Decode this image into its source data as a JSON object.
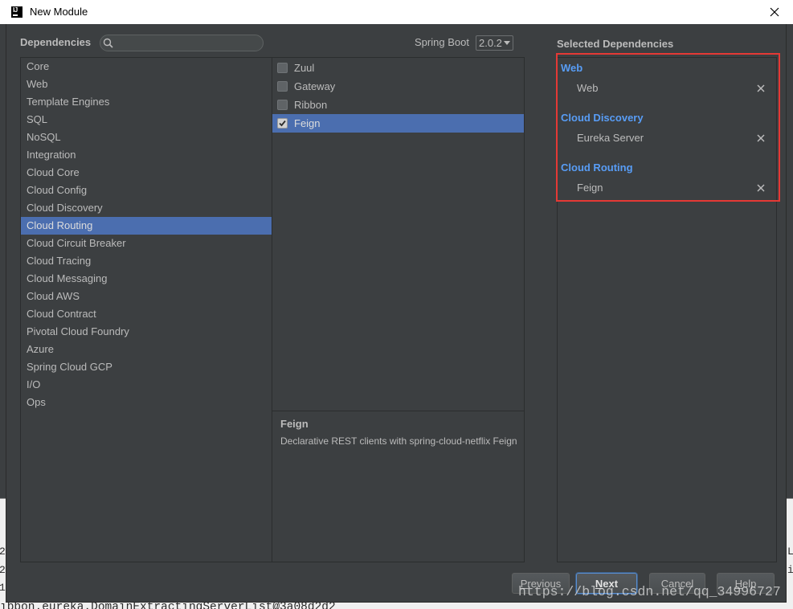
{
  "window": {
    "title": "New Module",
    "app_icon": {
      "name": "intellij-icon",
      "text": "IJ"
    },
    "close_icon": "close-icon"
  },
  "header": {
    "dependencies_label": "Dependencies",
    "search": {
      "value": "",
      "icon": "search-icon"
    },
    "spring_boot_label": "Spring Boot",
    "spring_boot_version": "2.0.2",
    "dropdown_icon": "chevron-down-icon",
    "selected_dependencies_label": "Selected Dependencies"
  },
  "categories": {
    "items": [
      {
        "label": "Core"
      },
      {
        "label": "Web"
      },
      {
        "label": "Template Engines"
      },
      {
        "label": "SQL"
      },
      {
        "label": "NoSQL"
      },
      {
        "label": "Integration"
      },
      {
        "label": "Cloud Core"
      },
      {
        "label": "Cloud Config"
      },
      {
        "label": "Cloud Discovery"
      },
      {
        "label": "Cloud Routing",
        "selected": true
      },
      {
        "label": "Cloud Circuit Breaker"
      },
      {
        "label": "Cloud Tracing"
      },
      {
        "label": "Cloud Messaging"
      },
      {
        "label": "Cloud AWS"
      },
      {
        "label": "Cloud Contract"
      },
      {
        "label": "Pivotal Cloud Foundry"
      },
      {
        "label": "Azure"
      },
      {
        "label": "Spring Cloud GCP"
      },
      {
        "label": "I/O"
      },
      {
        "label": "Ops"
      }
    ]
  },
  "dependencies": {
    "items": [
      {
        "label": "Zuul",
        "checked": false
      },
      {
        "label": "Gateway",
        "checked": false
      },
      {
        "label": "Ribbon",
        "checked": false
      },
      {
        "label": "Feign",
        "checked": true,
        "selected": true
      }
    ]
  },
  "description": {
    "title": "Feign",
    "text": "Declarative REST clients with spring-cloud-netflix Feign"
  },
  "selected": {
    "remove_icon": "remove-icon",
    "groups": [
      {
        "name": "Web",
        "items": [
          "Web"
        ]
      },
      {
        "name": "Cloud Discovery",
        "items": [
          "Eureka Server"
        ]
      },
      {
        "name": "Cloud Routing",
        "items": [
          "Feign"
        ]
      }
    ]
  },
  "buttons": {
    "previous": "Previous",
    "next": "Next",
    "cancel": "Cancel",
    "help": "Help"
  },
  "watermark": "https://blog.csdn.net/qq_34996727",
  "background": {
    "console_text": "ibbon.eureka.DomainExtractingServerList@3a08d2d2",
    "left_fragments": [
      "2",
      "2",
      "1"
    ],
    "right_fragments": [
      "L",
      "i"
    ]
  },
  "colors": {
    "selection": "#4b6eaf",
    "group_title": "#589df6",
    "annotation_box": "#e53935",
    "text": "#bbbbbb"
  }
}
